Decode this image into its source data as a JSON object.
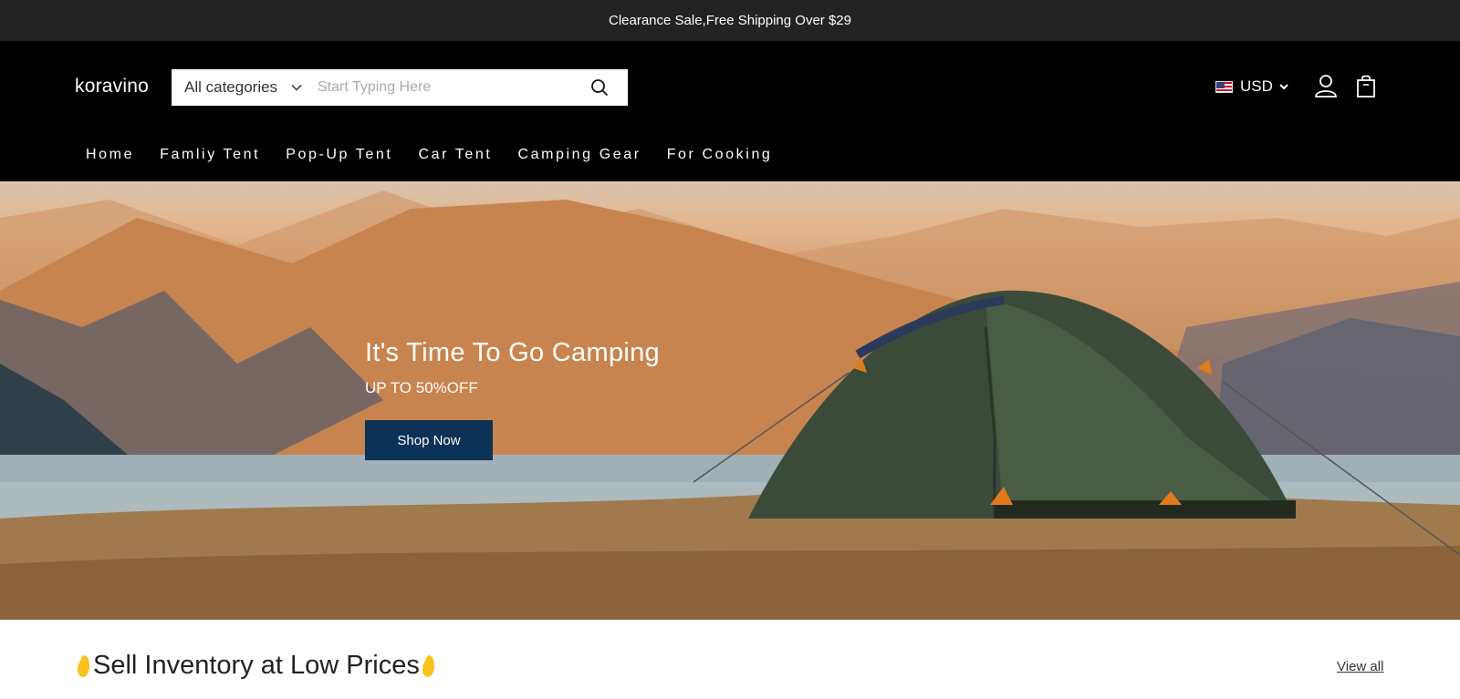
{
  "announcement": "Clearance Sale,Free Shipping Over $29",
  "header": {
    "logo": "koravino",
    "search": {
      "category": "All categories",
      "placeholder": "Start Typing Here"
    },
    "currency": "USD",
    "icons": {
      "search": "search-icon",
      "account": "user-icon",
      "cart": "shopping-bag-icon",
      "flag": "us-flag-icon"
    }
  },
  "nav": {
    "items": [
      {
        "label": "Home"
      },
      {
        "label": "Famliy Tent"
      },
      {
        "label": "Pop-Up Tent"
      },
      {
        "label": "Car Tent"
      },
      {
        "label": "Camping Gear"
      },
      {
        "label": "For Cooking"
      }
    ]
  },
  "hero": {
    "title": "It's Time To Go Camping",
    "subtitle": "UP TO 50%OFF",
    "button": "Shop Now"
  },
  "section": {
    "title": "Sell Inventory at Low Prices",
    "view_all": "View all"
  },
  "colors": {
    "announcement_bg": "#222222",
    "header_bg": "#000000",
    "button_bg": "#0b3255"
  }
}
